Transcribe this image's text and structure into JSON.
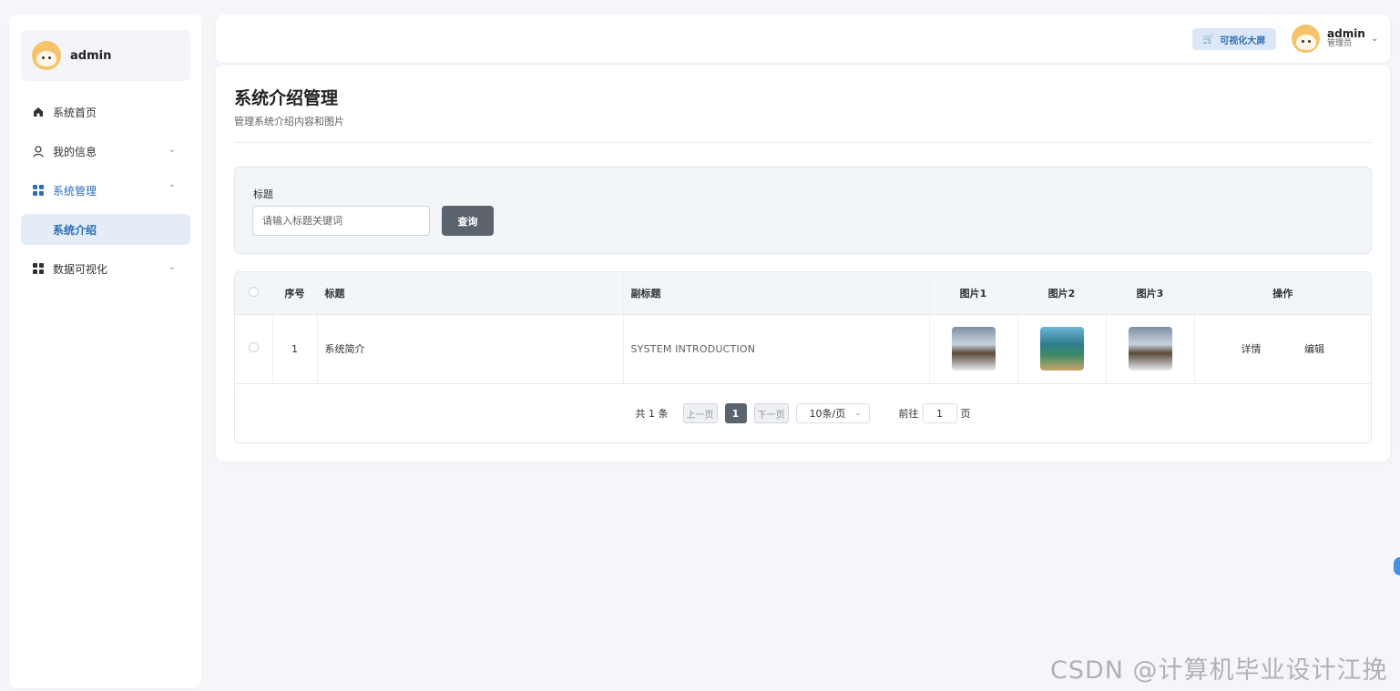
{
  "sidebar": {
    "user": {
      "name": "admin"
    },
    "menu": [
      {
        "label": "系统首页",
        "icon": "home-icon"
      },
      {
        "label": "我的信息",
        "icon": "user-icon"
      },
      {
        "label": "系统管理",
        "icon": "grid-icon"
      },
      {
        "label": "系统介绍",
        "icon": ""
      },
      {
        "label": "数据可视化",
        "icon": "grid-icon"
      }
    ]
  },
  "topbar": {
    "big_screen_label": "可视化大屏",
    "user_name": "admin",
    "user_role": "管理员"
  },
  "page": {
    "title": "系统介绍管理",
    "subtitle": "管理系统介绍内容和图片"
  },
  "search": {
    "label": "标题",
    "placeholder": "请输入标题关键词",
    "button_label": "查询"
  },
  "table": {
    "headers": {
      "index": "序号",
      "title": "标题",
      "subtitle": "副标题",
      "image1": "图片1",
      "image2": "图片2",
      "image3": "图片3",
      "actions": "操作"
    },
    "rows": [
      {
        "index": "1",
        "title": "系统简介",
        "subtitle": "SYSTEM INTRODUCTION",
        "detail_label": "详情",
        "edit_label": "编辑"
      }
    ]
  },
  "pagination": {
    "total_text": "共 1 条",
    "prev_label": "上一页",
    "current_page": "1",
    "next_label": "下一页",
    "page_size": "10条/页",
    "goto_prefix": "前往",
    "goto_value": "1",
    "goto_suffix": "页"
  },
  "watermark": "CSDN @计算机毕业设计江挽",
  "colors": {
    "accent": "#2f6db5",
    "button_dark": "#5b636d",
    "background": "#f4f6fa"
  }
}
